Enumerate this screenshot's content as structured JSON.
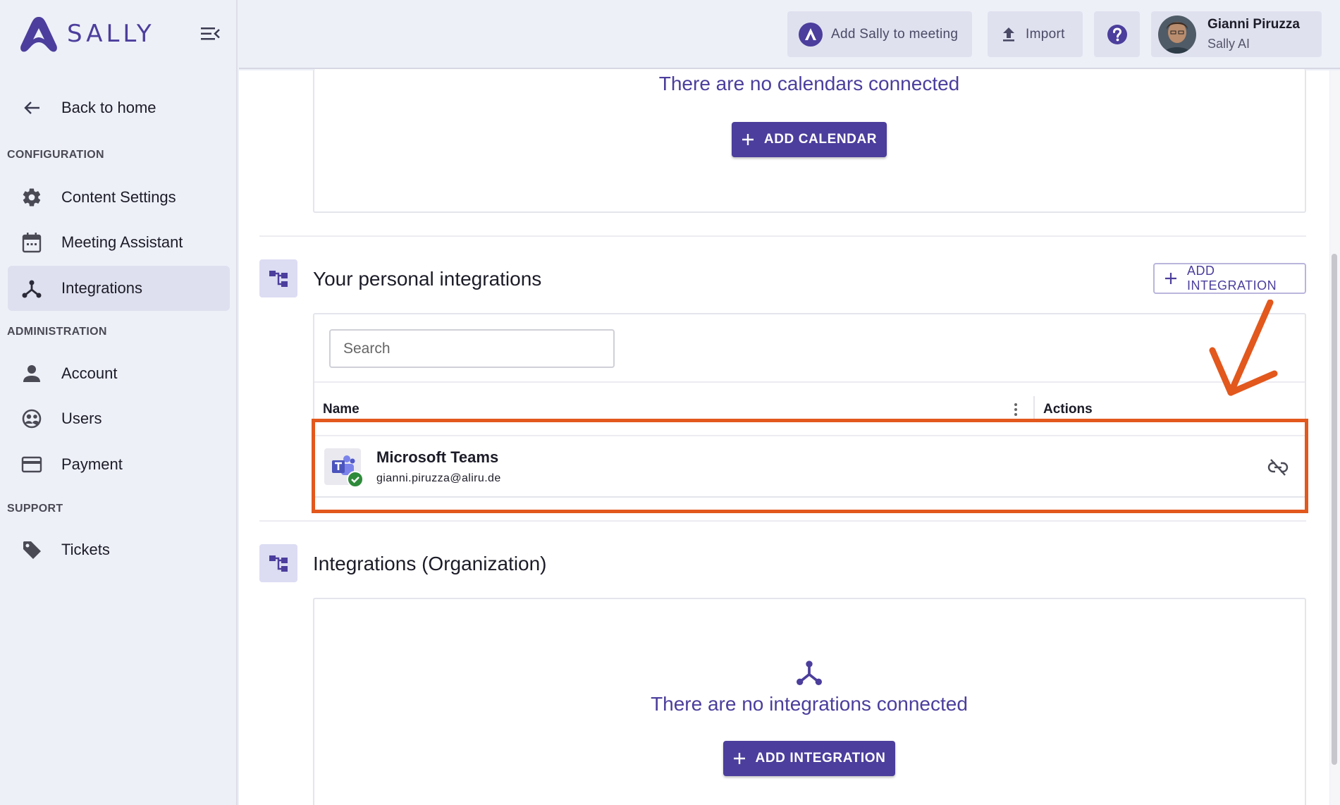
{
  "app": {
    "logo_text": "SALLY"
  },
  "sidebar": {
    "back": "Back to home",
    "sections": {
      "configuration": "CONFIGURATION",
      "administration": "ADMINISTRATION",
      "support": "SUPPORT"
    },
    "items": {
      "content_settings": "Content Settings",
      "meeting_assistant": "Meeting Assistant",
      "integrations": "Integrations",
      "account": "Account",
      "users": "Users",
      "payment": "Payment",
      "tickets": "Tickets"
    },
    "active_item": "Integrations"
  },
  "header": {
    "add_sally": "Add Sally to meeting",
    "import": "Import",
    "help_icon": "help-icon",
    "user_name": "Gianni Piruzza",
    "user_org": "Sally AI"
  },
  "calendars": {
    "empty_text": "There are no calendars connected",
    "add_button": "ADD CALENDAR"
  },
  "personal_integrations": {
    "title": "Your personal integrations",
    "add_button": "ADD INTEGRATION",
    "search_placeholder": "Search",
    "columns": {
      "name": "Name",
      "actions": "Actions"
    },
    "rows": [
      {
        "name": "Microsoft Teams",
        "email": "gianni.piruzza@aliru.de",
        "status": "connected"
      }
    ]
  },
  "org_integrations": {
    "title": "Integrations (Organization)",
    "empty_text": "There are no integrations connected",
    "add_button": "ADD INTEGRATION"
  },
  "colors": {
    "brand": "#4b3e9c",
    "highlight": "#e2581d",
    "success": "#2e8b3a"
  }
}
